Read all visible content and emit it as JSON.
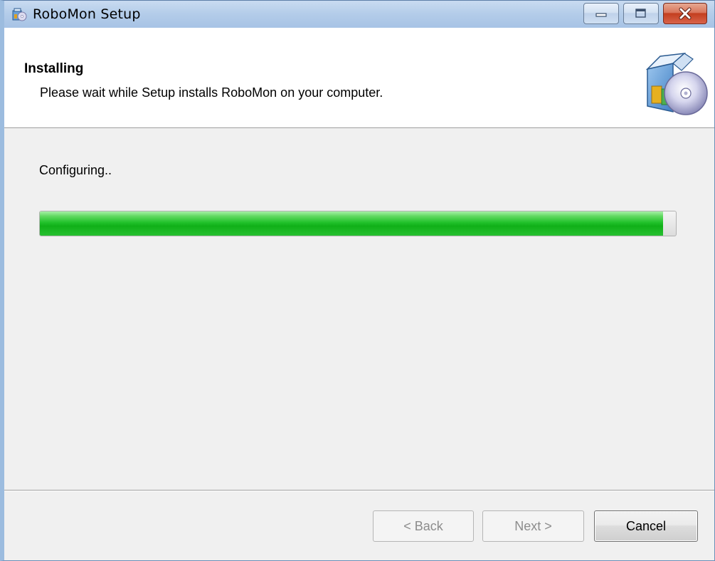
{
  "window": {
    "title": "RoboMon Setup",
    "icon": "installer-box-icon"
  },
  "titlebar_buttons": {
    "minimize_icon": "minimize-icon",
    "maximize_icon": "maximize-icon",
    "close_icon": "close-icon"
  },
  "header": {
    "title": "Installing",
    "subtitle": "Please wait while Setup installs RoboMon on your computer.",
    "icon": "setup-box-cd-icon"
  },
  "progress": {
    "status": "Configuring..",
    "percent": 98
  },
  "footer": {
    "back_label": "< Back",
    "next_label": "Next >",
    "cancel_label": "Cancel"
  },
  "colors": {
    "progress_green": "#10b018",
    "title_bar": "#b3cce9"
  }
}
